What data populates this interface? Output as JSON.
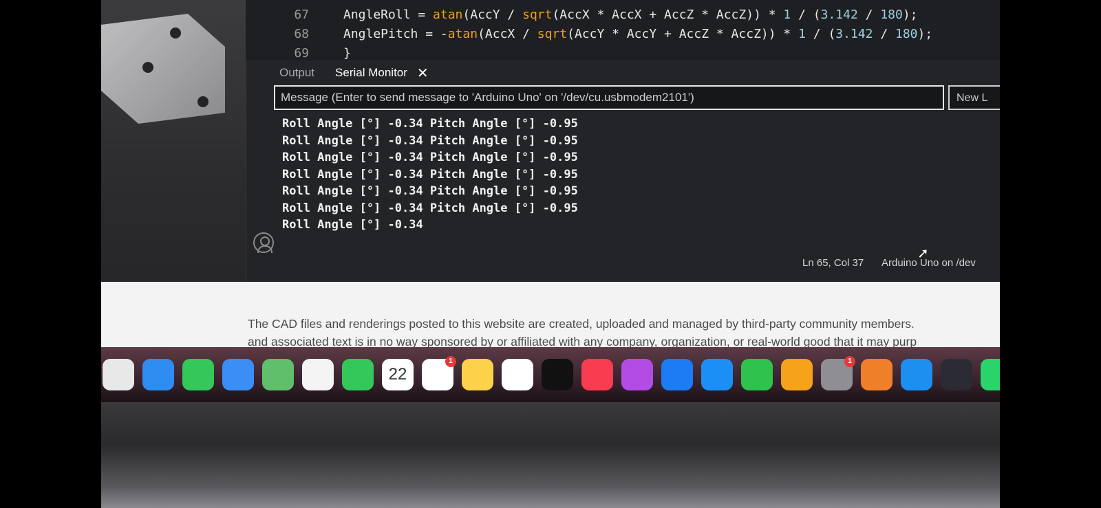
{
  "editor": {
    "lines": [
      {
        "number": "67",
        "code": "AngleRoll = atan(AccY / sqrt(AccX * AccX + AccZ * AccZ)) * 1 / (3.142 / 180);"
      },
      {
        "number": "68",
        "code": "AnglePitch = -atan(AccX / sqrt(AccY * AccY + AccZ * AccZ)) * 1 / (3.142 / 180);"
      },
      {
        "number": "69",
        "code": "}"
      }
    ]
  },
  "panel": {
    "tabs": [
      {
        "label": "Output",
        "active": false
      },
      {
        "label": "Serial Monitor",
        "active": true
      }
    ],
    "close_glyph": "✕",
    "message_placeholder": "Message (Enter to send message to 'Arduino Uno' on '/dev/cu.usbmodem2101')",
    "line_ending": "New L",
    "serial_output": [
      "Roll Angle [°] -0.34 Pitch Angle [°] -0.95",
      "Roll Angle [°] -0.34 Pitch Angle [°] -0.95",
      "Roll Angle [°] -0.34 Pitch Angle [°] -0.95",
      "Roll Angle [°] -0.34 Pitch Angle [°] -0.95",
      "Roll Angle [°] -0.34 Pitch Angle [°] -0.95",
      "Roll Angle [°] -0.34 Pitch Angle [°] -0.95",
      "Roll Angle [°] -0.34"
    ]
  },
  "status": {
    "position": "Ln 65, Col 37",
    "board": "Arduino Uno on /dev"
  },
  "webpage": {
    "disclaimer": "The CAD files and renderings posted to this website are created, uploaded and managed by third-party community members.",
    "disclaimer_line2": "and associated text is in no way sponsored by or affiliated with any company, organization, or real-world good that it may purp"
  },
  "dock": {
    "calendar_day": "22",
    "apps": [
      {
        "name": "chrome-icon",
        "color": "#e8e8e8",
        "badge": ""
      },
      {
        "name": "safari-icon",
        "color": "#2f8cf0",
        "badge": ""
      },
      {
        "name": "messages-icon",
        "color": "#35c759",
        "badge": ""
      },
      {
        "name": "mail-icon",
        "color": "#3a8ef6",
        "badge": ""
      },
      {
        "name": "maps-icon",
        "color": "#5fbf6a",
        "badge": ""
      },
      {
        "name": "photos-icon",
        "color": "#f4f4f4",
        "badge": ""
      },
      {
        "name": "facetime-icon",
        "color": "#34c759",
        "badge": ""
      },
      {
        "name": "calendar-icon",
        "color": "#ffffff",
        "badge": ""
      },
      {
        "name": "reminders-icon",
        "color": "#ffffff",
        "badge": "1"
      },
      {
        "name": "notes-icon",
        "color": "#fbd24a",
        "badge": ""
      },
      {
        "name": "freeform-icon",
        "color": "#ffffff",
        "badge": ""
      },
      {
        "name": "apple-tv-icon",
        "color": "#111111",
        "badge": ""
      },
      {
        "name": "music-icon",
        "color": "#fa3c50",
        "badge": ""
      },
      {
        "name": "podcasts-icon",
        "color": "#b24ce5",
        "badge": ""
      },
      {
        "name": "keynote-icon",
        "color": "#1c7cf4",
        "badge": ""
      },
      {
        "name": "app-store-icon",
        "color": "#1b8ff5",
        "badge": ""
      },
      {
        "name": "numbers-icon",
        "color": "#2fc24c",
        "badge": ""
      },
      {
        "name": "pages-icon",
        "color": "#f6a21b",
        "badge": ""
      },
      {
        "name": "system-settings-icon",
        "color": "#8e8e93",
        "badge": "1"
      },
      {
        "name": "fusion-icon",
        "color": "#f07f2a",
        "badge": ""
      },
      {
        "name": "docker-icon",
        "color": "#1d8ff0",
        "badge": ""
      },
      {
        "name": "atom-icon",
        "color": "#2b2b36",
        "badge": ""
      },
      {
        "name": "whatsapp-icon",
        "color": "#2bd46a",
        "badge": ""
      }
    ]
  }
}
